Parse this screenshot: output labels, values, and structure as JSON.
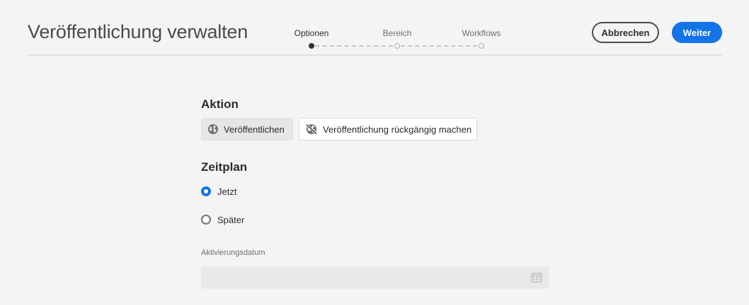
{
  "header": {
    "title": "Veröffentlichung verwalten",
    "steps": [
      {
        "label": "Optionen",
        "state": "active"
      },
      {
        "label": "Bereich",
        "state": "inactive"
      },
      {
        "label": "Workflows",
        "state": "inactive"
      }
    ],
    "cancel_label": "Abbrechen",
    "next_label": "Weiter"
  },
  "action": {
    "title": "Aktion",
    "options": [
      {
        "label": "Veröffentlichen",
        "icon": "globe-icon",
        "selected": true
      },
      {
        "label": "Veröffentlichung rückgängig machen",
        "icon": "globe-strike-icon",
        "selected": false
      }
    ]
  },
  "schedule": {
    "title": "Zeitplan",
    "options": [
      {
        "label": "Jetzt",
        "checked": true
      },
      {
        "label": "Später",
        "checked": false
      }
    ],
    "activation_date": {
      "label": "Aktivierungsdatum",
      "value": "",
      "placeholder": "",
      "icon": "calendar-icon"
    }
  },
  "colors": {
    "accent": "#1473e6",
    "background": "#f4f4f4"
  }
}
